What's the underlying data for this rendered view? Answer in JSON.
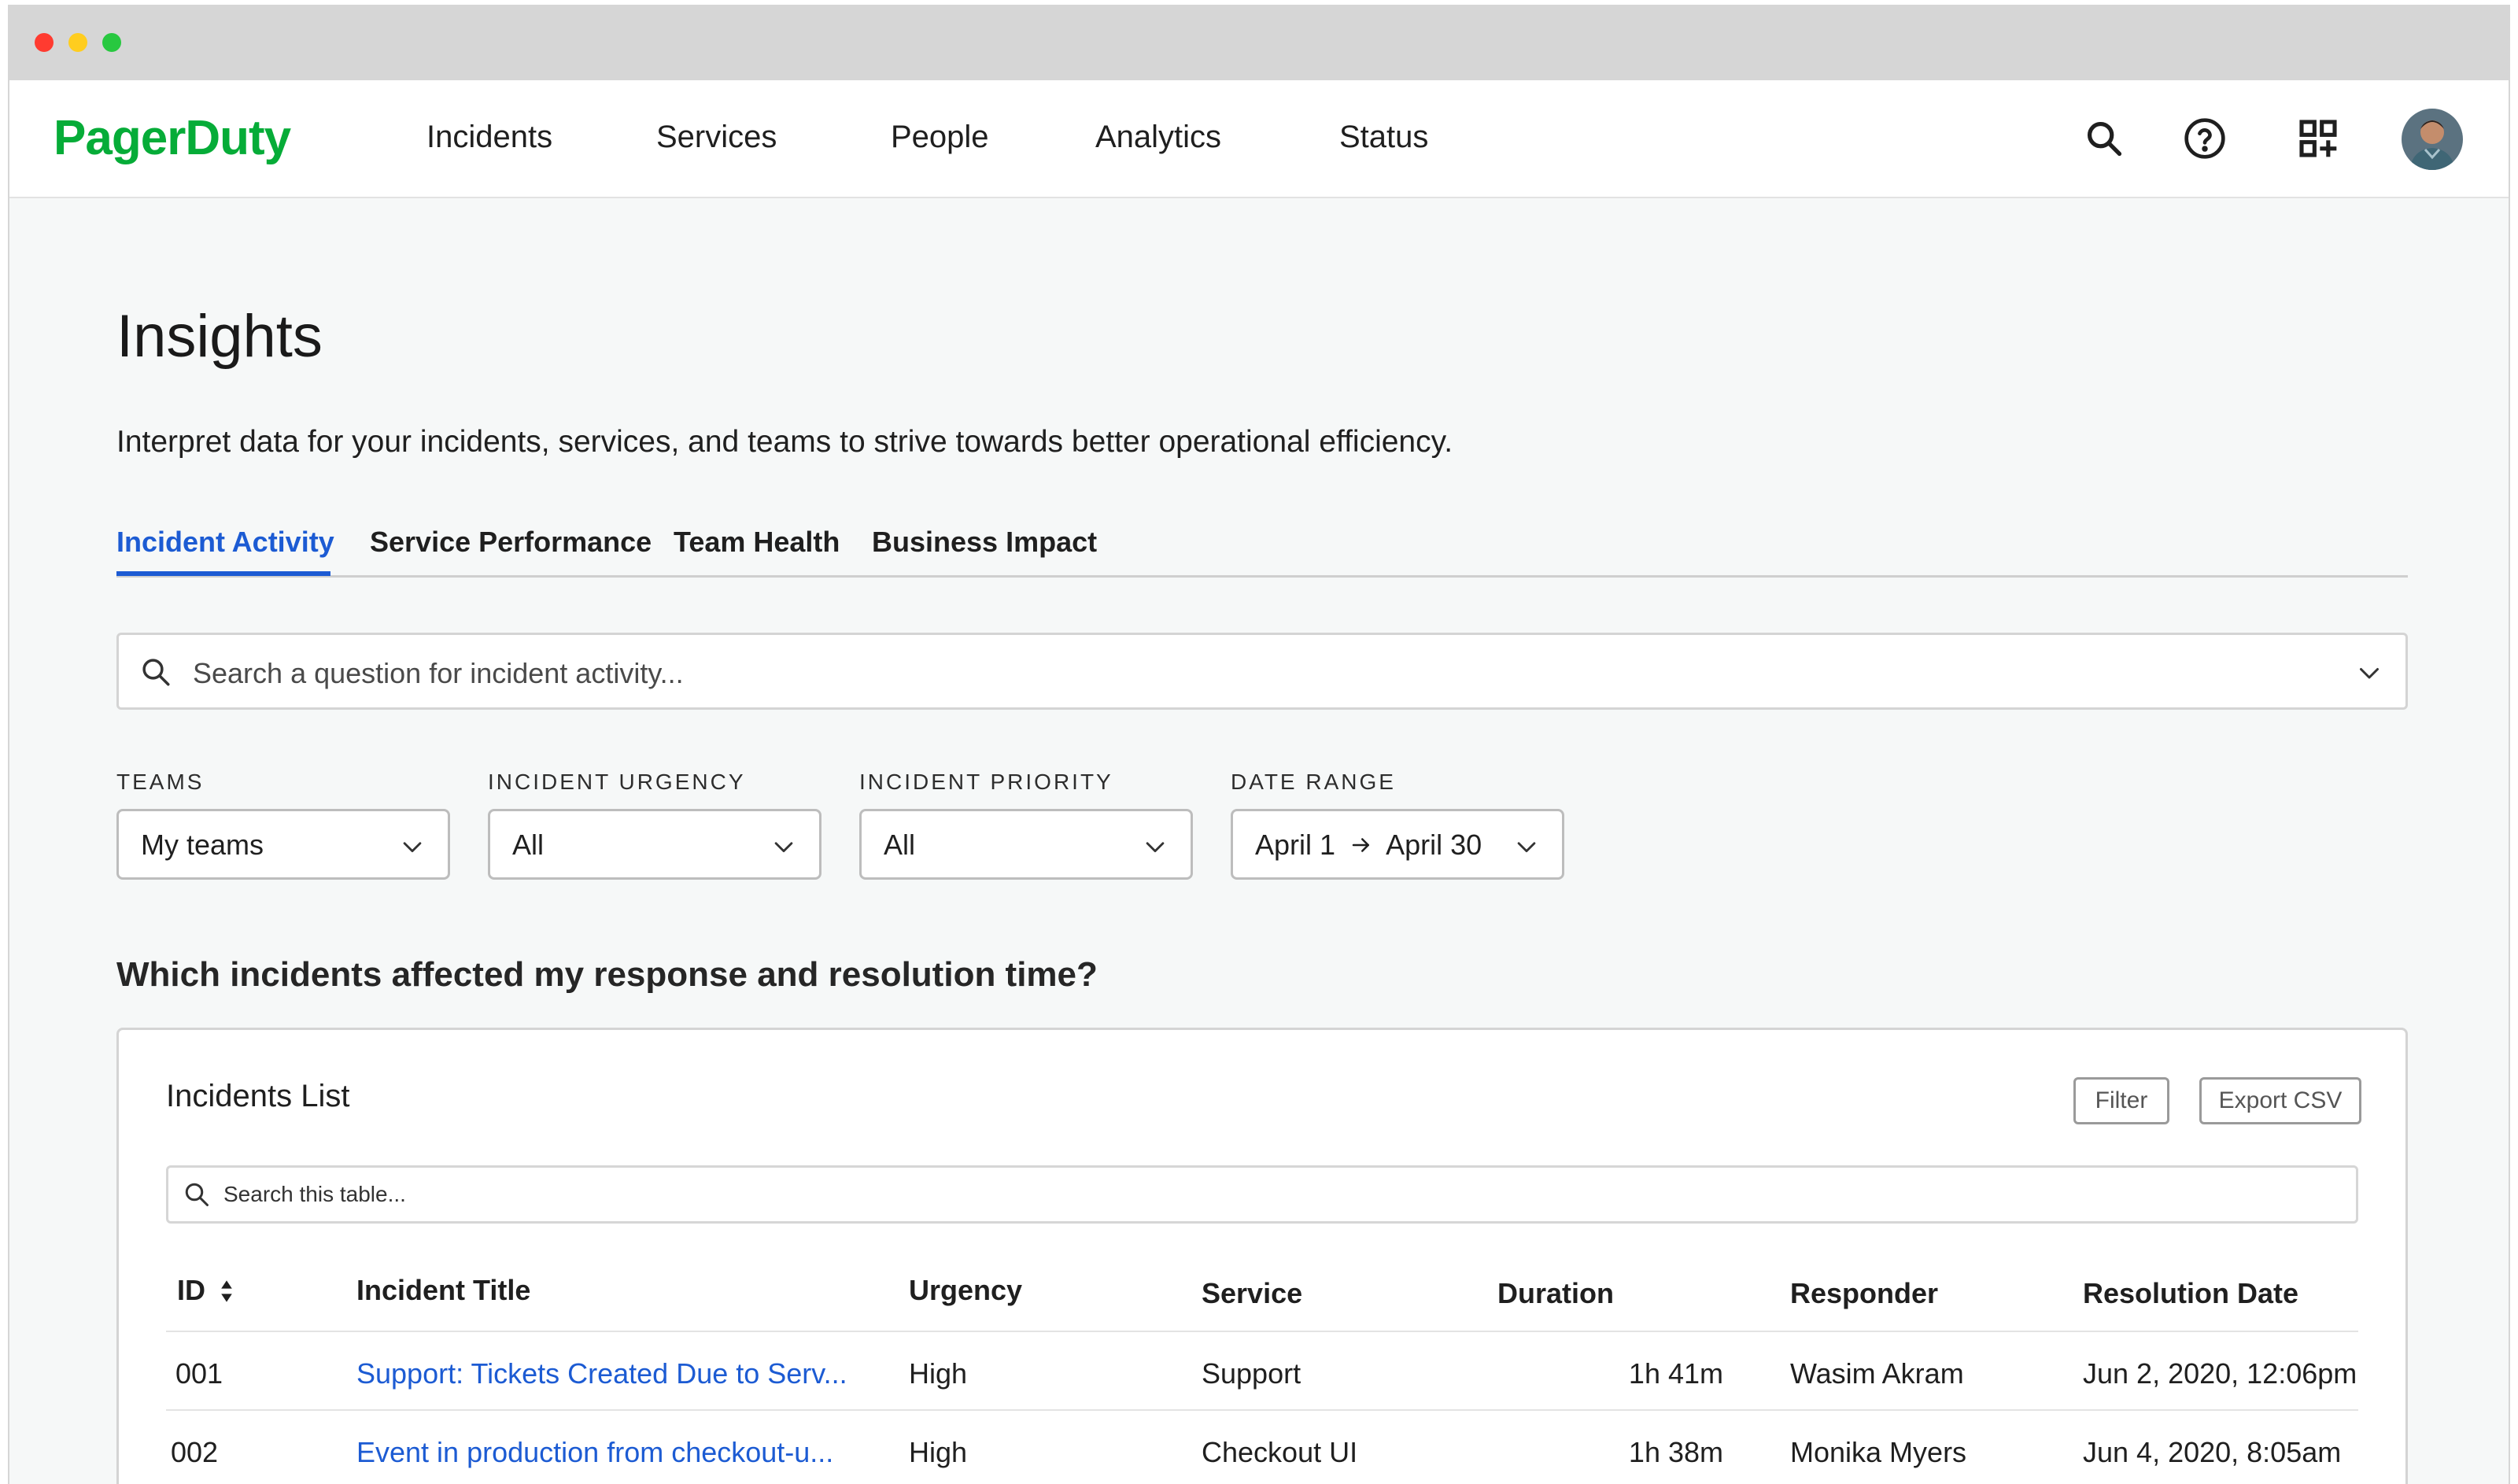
{
  "app": {
    "logo": "PagerDuty"
  },
  "nav": {
    "items": [
      "Incidents",
      "Services",
      "People",
      "Analytics",
      "Status"
    ]
  },
  "page": {
    "title": "Insights",
    "description": "Interpret data for your incidents, services, and teams to strive towards better operational efficiency."
  },
  "tabs": [
    {
      "label": "Incident Activity",
      "active": true
    },
    {
      "label": "Service Performance",
      "active": false
    },
    {
      "label": "Team Health",
      "active": false
    },
    {
      "label": "Business Impact",
      "active": false
    }
  ],
  "search": {
    "placeholder": "Search a question for incident activity..."
  },
  "filters": [
    {
      "label": "TEAMS",
      "value": "My teams"
    },
    {
      "label": "INCIDENT URGENCY",
      "value": "All"
    },
    {
      "label": "INCIDENT PRIORITY",
      "value": "All"
    },
    {
      "label": "DATE RANGE",
      "value_from": "April 1",
      "value_to": "April 30"
    }
  ],
  "question": "Which incidents affected my response and resolution time?",
  "incidents_card": {
    "title": "Incidents List",
    "filter_label": "Filter",
    "export_label": "Export CSV",
    "search_placeholder": "Search this table...",
    "columns": [
      "ID",
      "Incident Title",
      "Urgency",
      "Service",
      "Duration",
      "Responder",
      "Resolution Date"
    ],
    "rows": [
      {
        "id": "001",
        "title": "Support: Tickets Created Due to Serv...",
        "urgency": "High",
        "service": "Support",
        "duration": "1h 41m",
        "responder": "Wasim Akram",
        "resolution_date": "Jun 2, 2020, 12:06pm"
      },
      {
        "id": "002",
        "title": "Event in production from checkout-u...",
        "urgency": "High",
        "service": "Checkout UI",
        "duration": "1h 38m",
        "responder": "Monika Myers",
        "resolution_date": "Jun 4, 2020, 8:05am"
      }
    ]
  },
  "colors": {
    "brand": "#06ac38",
    "link": "#1c5bd3",
    "window_close": "#ff3b30",
    "window_minimize": "#ffcd1f",
    "window_zoom": "#28c840"
  }
}
